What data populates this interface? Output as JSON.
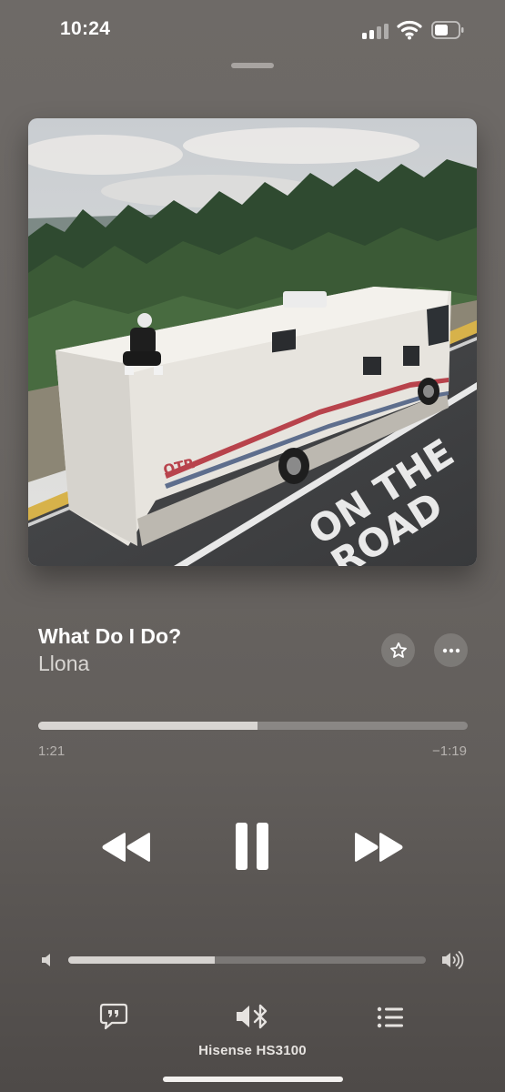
{
  "status_bar": {
    "time": "10:24",
    "signal_icon": "cellular-signal-icon",
    "wifi_icon": "wifi-icon",
    "battery_icon": "battery-icon"
  },
  "now_playing": {
    "artwork_icon": "album-artwork",
    "artwork_text": "OTR · ON THE ROAD",
    "title": "What Do I Do?",
    "artist": "Llona",
    "favorite_icon": "star-icon",
    "more_icon": "ellipsis-icon"
  },
  "progress": {
    "elapsed": "1:21",
    "remaining": "−1:19",
    "fraction": 0.51
  },
  "controls": {
    "rewind_icon": "rewind-icon",
    "pause_icon": "pause-icon",
    "forward_icon": "fast-forward-icon"
  },
  "volume": {
    "level": 0.41,
    "low_icon": "volume-low-icon",
    "high_icon": "volume-high-icon"
  },
  "bottom_bar": {
    "lyrics_icon": "lyrics-quote-icon",
    "output_icon": "bluetooth-speaker-icon",
    "queue_icon": "queue-list-icon",
    "device_name": "Hisense HS3100"
  },
  "colors": {
    "background": "#6a6663",
    "accent_fill": "#d8d5d2"
  }
}
